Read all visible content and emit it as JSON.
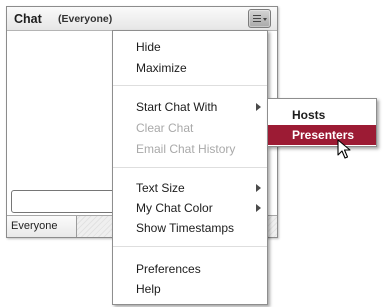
{
  "pod": {
    "title": "Chat",
    "audience_header": "(Everyone)",
    "menu_button_icon": "menu-lines-icon",
    "message_input_value": "",
    "audience_tab": "Everyone"
  },
  "menu": {
    "items": [
      {
        "label": "Hide",
        "enabled": true
      },
      {
        "label": "Maximize",
        "enabled": true
      },
      {
        "label": "Start Chat With",
        "enabled": true,
        "submenu": true
      },
      {
        "label": "Clear Chat",
        "enabled": false
      },
      {
        "label": "Email Chat History",
        "enabled": false
      },
      {
        "label": "Text Size",
        "enabled": true,
        "submenu": true
      },
      {
        "label": "My Chat Color",
        "enabled": true,
        "submenu": true
      },
      {
        "label": "Show Timestamps",
        "enabled": true
      },
      {
        "label": "Preferences",
        "enabled": true
      },
      {
        "label": "Help",
        "enabled": true
      }
    ]
  },
  "submenu": {
    "items": [
      {
        "label": "Hosts",
        "highlighted": false
      },
      {
        "label": "Presenters",
        "highlighted": true
      }
    ]
  },
  "colors": {
    "highlight": "#9c1b34",
    "disabled_text": "#a9a9a9",
    "menu_border": "#8e8e8e"
  }
}
